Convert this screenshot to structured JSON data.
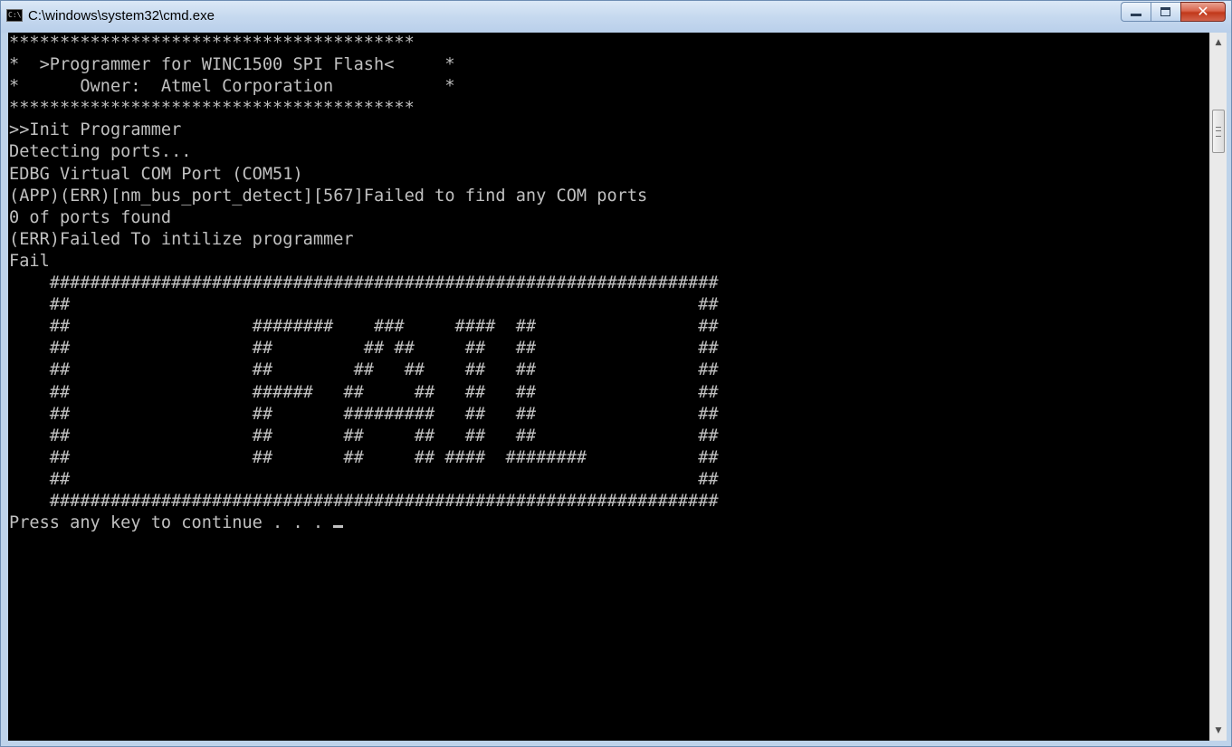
{
  "window": {
    "title": "C:\\windows\\system32\\cmd.exe",
    "icon_text": "C:\\.",
    "minimize_glyph": "",
    "maximize_glyph": "",
    "close_glyph": "✕"
  },
  "console": {
    "lines": [
      "****************************************",
      "*  >Programmer for WINC1500 SPI Flash<     *",
      "*      Owner:  Atmel Corporation           *",
      "****************************************",
      ">>Init Programmer",
      "Detecting ports...",
      "EDBG Virtual COM Port (COM51)",
      "(APP)(ERR)[nm_bus_port_detect][567]Failed to find any COM ports",
      "0 of ports found",
      "(ERR)Failed To intilize programmer",
      "Fail",
      "    ##################################################################",
      "    ##                                                              ##",
      "    ##                  ########    ###     ####  ##                ##",
      "    ##                  ##         ## ##     ##   ##                ##",
      "    ##                  ##        ##   ##    ##   ##                ##",
      "    ##                  ######   ##     ##   ##   ##                ##",
      "    ##                  ##       #########   ##   ##                ##",
      "    ##                  ##       ##     ##   ##   ##                ##",
      "    ##                  ##       ##     ## ####  ########           ##",
      "    ##                                                              ##",
      "    ##################################################################"
    ],
    "prompt": "Press any key to continue . . . "
  },
  "scrollbar": {
    "up_glyph": "▲",
    "down_glyph": "▼"
  },
  "colors": {
    "console_bg": "#000000",
    "console_fg": "#c0c0c0",
    "titlebar": "#c6d9ef",
    "close_button": "#c1381a"
  }
}
